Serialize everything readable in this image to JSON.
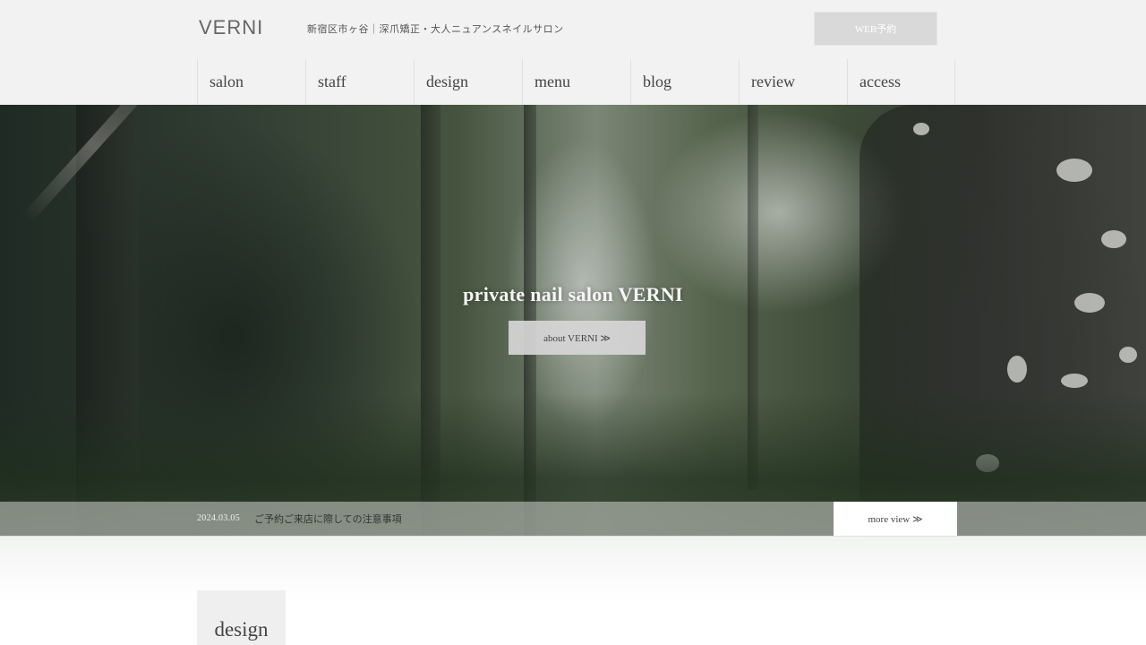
{
  "header": {
    "logo": "VERNI",
    "tagline": "新宿区市ヶ谷｜深爪矯正・大人ニュアンスネイルサロン",
    "web_reserve_label": "WEB予約"
  },
  "nav": {
    "items": [
      {
        "label": "salon"
      },
      {
        "label": "staff"
      },
      {
        "label": "design"
      },
      {
        "label": "menu"
      },
      {
        "label": "blog"
      },
      {
        "label": "review"
      },
      {
        "label": "access"
      }
    ]
  },
  "hero": {
    "title": "private nail salon VERNI",
    "about_button": "about VERNI ≫"
  },
  "news": {
    "date": "2024.03.05",
    "title": "ご予約ご来店に際しての注意事項",
    "more_button": "more view ≫"
  },
  "sections": {
    "design_heading": "design"
  },
  "colors": {
    "header_bg": "#f2f2f2",
    "button_gray": "#d9d9d9",
    "text_dark": "#444444"
  }
}
